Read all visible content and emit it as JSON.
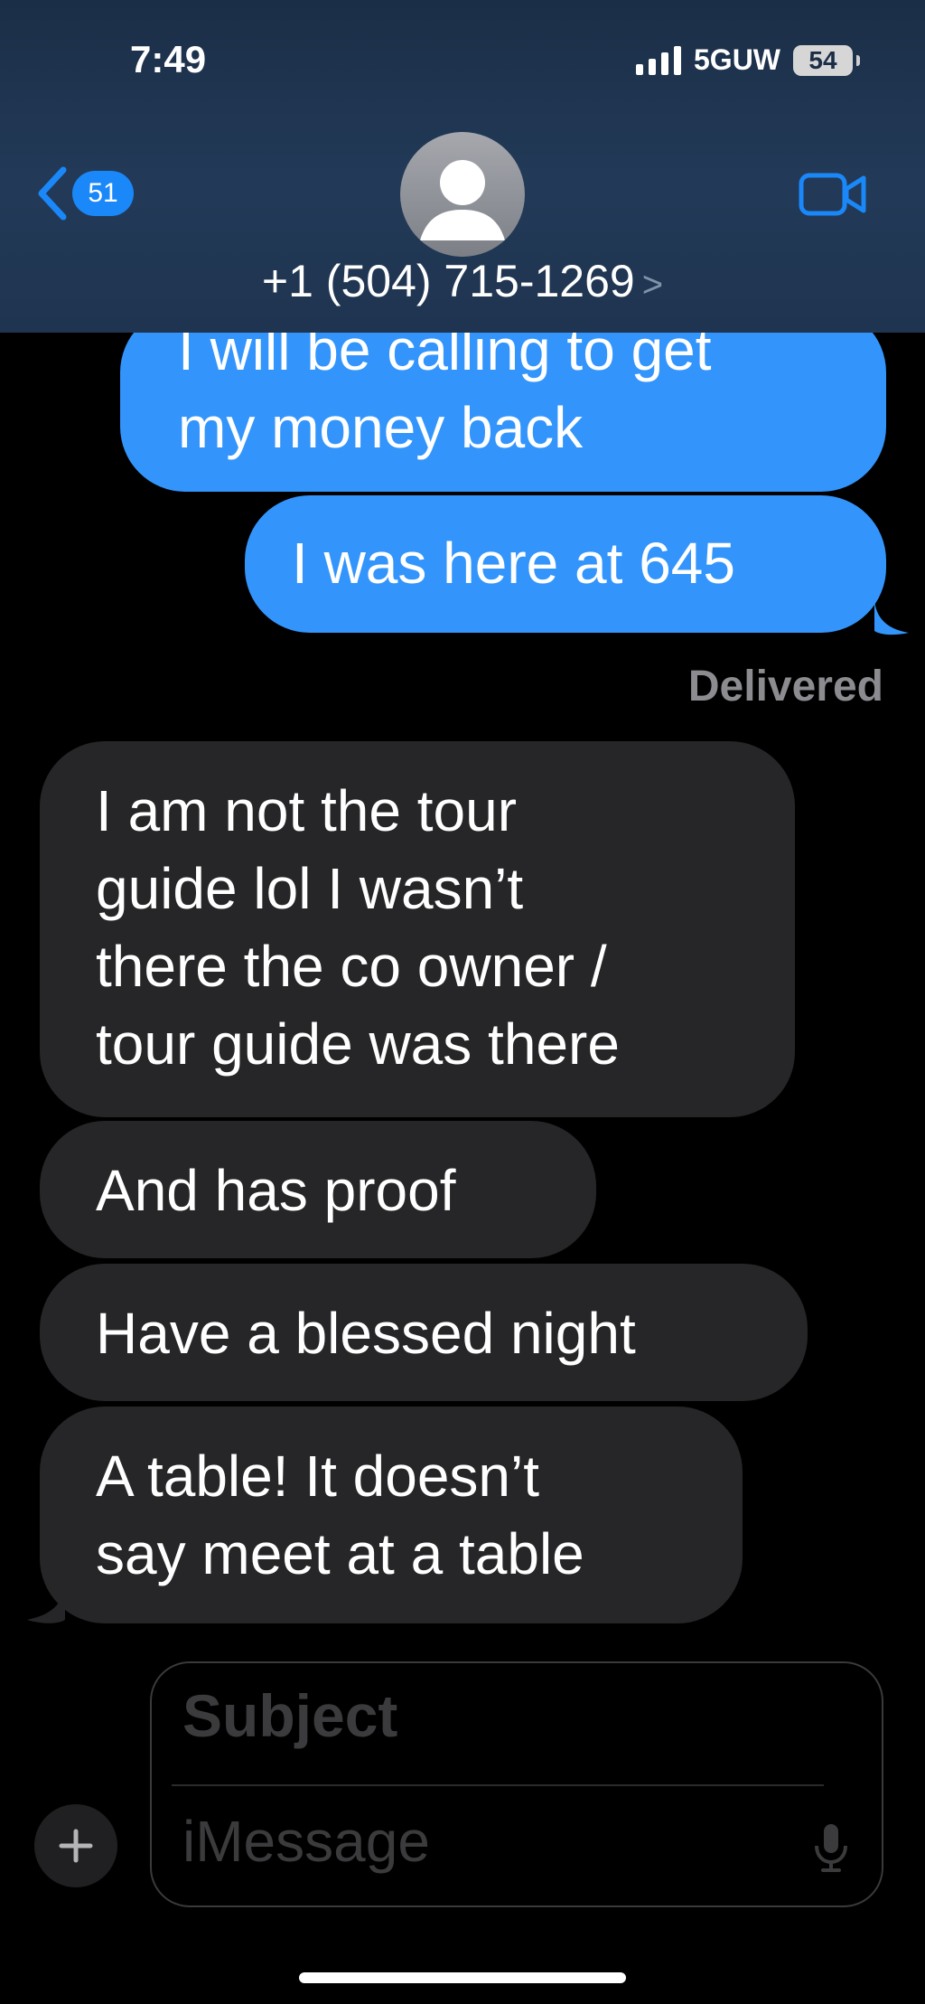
{
  "status_bar": {
    "time": "7:49",
    "network": "5GUW",
    "battery": "54"
  },
  "header": {
    "back_count": "51",
    "contact_name": "+1 (504) 715-1269",
    "contact_chevron": ">"
  },
  "messages": [
    {
      "direction": "outgoing",
      "lines": [
        "I will be calling to get",
        "my money back"
      ]
    },
    {
      "direction": "outgoing",
      "lines": [
        "I was here at 645"
      ]
    },
    {
      "direction": "incoming",
      "lines": [
        "I am not the tour",
        "guide lol I wasn’t",
        "there the co owner /",
        "tour guide was there"
      ]
    },
    {
      "direction": "incoming",
      "lines": [
        "And has proof"
      ]
    },
    {
      "direction": "incoming",
      "lines": [
        "Have a blessed night"
      ]
    },
    {
      "direction": "incoming",
      "lines": [
        "A table! It doesn’t",
        "say meet at a table"
      ]
    }
  ],
  "delivery_status": "Delivered",
  "composer": {
    "subject_placeholder": "Subject",
    "message_placeholder": "iMessage"
  },
  "colors": {
    "outgoing_bubble": "#3395fb",
    "incoming_bubble": "#262628",
    "accent": "#1a88f8"
  },
  "icons": [
    "back-chevron-icon",
    "person-icon",
    "video-camera-icon",
    "plus-icon",
    "microphone-icon",
    "signal-icon",
    "battery-icon"
  ]
}
